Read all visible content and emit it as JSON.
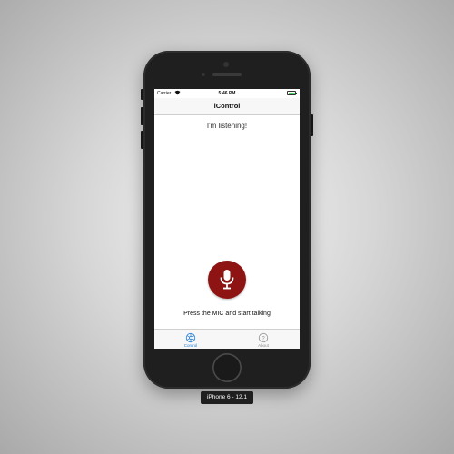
{
  "status_bar": {
    "carrier": "Carrier",
    "time": "5:46 PM",
    "wifi_icon": "wifi-icon",
    "battery_icon": "battery-icon",
    "battery_color": "#4cd964"
  },
  "nav_bar": {
    "title": "iControl"
  },
  "main": {
    "status_text": "I'm listening!",
    "mic_icon": "microphone-icon",
    "mic_color": "#8e1414",
    "prompt_text": "Press the MIC and start talking"
  },
  "tab_bar": {
    "tabs": [
      {
        "label": "Control",
        "icon": "control-wheel-icon",
        "selected": true,
        "color": "#1e7bd8"
      },
      {
        "label": "About",
        "icon": "question-circle-icon",
        "selected": false,
        "color": "#8e8e93"
      }
    ]
  },
  "simulator": {
    "device_label": "iPhone 6 - 12.1"
  }
}
